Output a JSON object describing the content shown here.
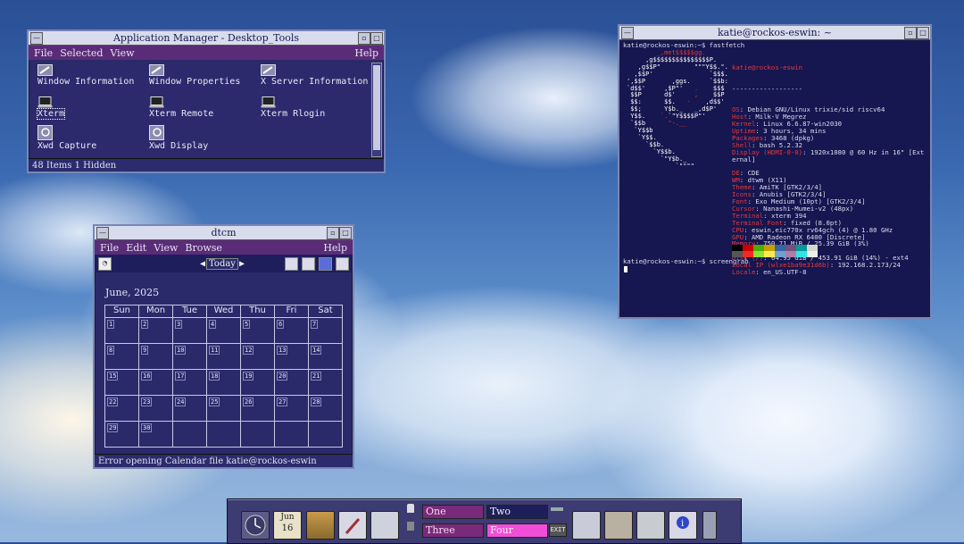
{
  "appmgr": {
    "title": "Application Manager - Desktop_Tools",
    "menu": [
      "File",
      "Selected",
      "View"
    ],
    "help": "Help",
    "items": [
      {
        "label": "Window Information",
        "icon": "tools-icon"
      },
      {
        "label": "Window Properties",
        "icon": "tools-icon"
      },
      {
        "label": "X Server Information",
        "icon": "tools-icon"
      },
      {
        "label": "Xterm",
        "icon": "terminal-icon"
      },
      {
        "label": "Xterm Remote",
        "icon": "terminal-icon"
      },
      {
        "label": "Xterm Rlogin",
        "icon": "terminal-icon"
      },
      {
        "label": "Xwd Capture",
        "icon": "tools-icon"
      },
      {
        "label": "Xwd Display",
        "icon": "tools-icon"
      }
    ],
    "status": "48 Items 1 Hidden"
  },
  "dtcm": {
    "title": "dtcm",
    "menu": [
      "File",
      "Edit",
      "View",
      "Browse"
    ],
    "help": "Help",
    "today": "Today",
    "month": "June, 2025",
    "weekdays": [
      "Sun",
      "Mon",
      "Tue",
      "Wed",
      "Thu",
      "Fri",
      "Sat"
    ],
    "weeks": [
      [
        "1",
        "2",
        "3",
        "4",
        "5",
        "6",
        "7"
      ],
      [
        "8",
        "9",
        "10",
        "11",
        "12",
        "13",
        "14"
      ],
      [
        "15",
        "16",
        "17",
        "18",
        "19",
        "20",
        "21"
      ],
      [
        "22",
        "23",
        "24",
        "25",
        "26",
        "27",
        "28"
      ],
      [
        "29",
        "30",
        "",
        "",
        "",
        "",
        ""
      ]
    ],
    "status": "Error opening Calendar file katie@rockos-eswin"
  },
  "terminal": {
    "title": "katie@rockos-eswin: ~",
    "prompt1": "katie@rockos-eswin:~$ fastfetch",
    "header": "katie@rockos-eswin",
    "rule": "------------------",
    "info": [
      {
        "k": "OS",
        "v": ": Debian GNU/Linux trixie/sid riscv64"
      },
      {
        "k": "Host",
        "v": ": Milk-V Megrez"
      },
      {
        "k": "Kernel",
        "v": ": Linux 6.6.87-win2030"
      },
      {
        "k": "Uptime",
        "v": ": 3 hours, 34 mins"
      },
      {
        "k": "Packages",
        "v": ": 3468 (dpkg)"
      },
      {
        "k": "Shell",
        "v": ": bash 5.2.32"
      },
      {
        "k": "Display (HDMI-0-0)",
        "v": ": 1920x1080 @ 60 Hz in 16\" [Ext"
      },
      {
        "k": "",
        "v": "ernal]"
      },
      {
        "k": "",
        "v": ""
      },
      {
        "k": "DE",
        "v": ": CDE"
      },
      {
        "k": "WM",
        "v": ": dtwm (X11)"
      },
      {
        "k": "Theme",
        "v": ": AmiTK [GTK2/3/4]"
      },
      {
        "k": "Icons",
        "v": ": Anubis [GTK2/3/4]"
      },
      {
        "k": "Font",
        "v": ": Exo Medium (10pt) [GTK2/3/4]"
      },
      {
        "k": "Cursor",
        "v": ": Nanashi-Mumei-v2 (48px)"
      },
      {
        "k": "Terminal",
        "v": ": xterm 394"
      },
      {
        "k": "Terminal Font",
        "v": ": fixed (8.0pt)"
      },
      {
        "k": "CPU",
        "v": ": eswin,eic770x rv64gch (4) @ 1.80 GHz"
      },
      {
        "k": "GPU",
        "v": ": AMD Radeon RX 6400 [Discrete]"
      },
      {
        "k": "Memory",
        "v": ": 750.71 MiB / 25.39 GiB (3%)"
      },
      {
        "k": "Swap",
        "v": ": Disabled"
      },
      {
        "k": "Disk (/)",
        "v": ": 64.95 GiB / 453.91 GiB (14%) - ext4"
      },
      {
        "k": "Local IP (wlxe1ba9e31d6b)",
        "v": ": 192.168.2.173/24"
      },
      {
        "k": "Locale",
        "v": ": en_US.UTF-8"
      }
    ],
    "prompt2": "katie@rockos-eswin:~$ screengrab",
    "palette_top": [
      "#000000",
      "#cc0000",
      "#4eaa06",
      "#c4a000",
      "#3465a4",
      "#75507b",
      "#06989a",
      "#d3d7cf"
    ],
    "palette_bot": [
      "#555753",
      "#ef2929",
      "#8ae234",
      "#fce94f",
      "#729fcf",
      "#ad7fa8",
      "#34e2e2",
      "#eeeeec"
    ]
  },
  "panel": {
    "calendar_month": "Jun",
    "calendar_day": "16",
    "workspaces": [
      "One",
      "Two",
      "Three",
      "Four"
    ],
    "exit_label": "EXIT"
  }
}
